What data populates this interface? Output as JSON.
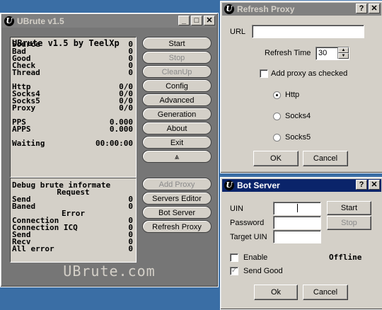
{
  "ubrute": {
    "title": "UBrute v1.5",
    "panel_title": "UBrute v1.5 by TeelXp",
    "stats": [
      {
        "label": "Source",
        "value": "0"
      },
      {
        "label": "Bad",
        "value": "0"
      },
      {
        "label": "Good",
        "value": "0"
      },
      {
        "label": "Check",
        "value": "0"
      },
      {
        "label": "Thread",
        "value": "0"
      },
      {
        "label": "Http",
        "value": "0/0"
      },
      {
        "label": "Socks4",
        "value": "0/0"
      },
      {
        "label": "Socks5",
        "value": "0/0"
      },
      {
        "label": "Proxy",
        "value": "0/0"
      },
      {
        "label": "PPS",
        "value": "0.000"
      },
      {
        "label": "APPS",
        "value": "0.000"
      },
      {
        "label": "Waiting",
        "value": "00:00:00"
      }
    ],
    "debug_title": "Debug brute informate",
    "debug_request": "Request",
    "debug_request_rows": [
      {
        "label": "Send",
        "value": "0"
      },
      {
        "label": "Baned",
        "value": "0"
      }
    ],
    "debug_error": "Error",
    "debug_error_rows": [
      {
        "label": "Connection",
        "value": "0"
      },
      {
        "label": "Connection ICQ",
        "value": "0"
      },
      {
        "label": "Send",
        "value": "0"
      },
      {
        "label": "Recv",
        "value": "0"
      },
      {
        "label": "All error",
        "value": "0"
      }
    ],
    "buttons": [
      "Start",
      "Stop",
      "CleanUp",
      "Config",
      "Advanced",
      "Generation",
      "About",
      "Exit",
      "⩓"
    ],
    "buttons2": [
      "Add Proxy",
      "Servers Editor",
      "Bot Server",
      "Refresh Proxy"
    ],
    "brand": "UBrute.com"
  },
  "refresh": {
    "title": "Refresh Proxy",
    "url_label": "URL",
    "url_value": "",
    "time_label": "Refresh Time",
    "time_value": "30",
    "add_checked_label": "Add proxy as checked",
    "radios": [
      "Http",
      "Socks4",
      "Socks5"
    ],
    "ok": "OK",
    "cancel": "Cancel"
  },
  "bot": {
    "title": "Bot Server",
    "uin_label": "UIN",
    "password_label": "Password",
    "target_label": "Target UIN",
    "start": "Start",
    "stop": "Stop",
    "enable_label": "Enable",
    "send_good_label": "Send Good",
    "status": "Offline",
    "ok": "Ok",
    "cancel": "Cancel"
  },
  "icons": {
    "app": "U",
    "minimize": "_",
    "maximize": "□",
    "close": "✕",
    "help": "?"
  }
}
